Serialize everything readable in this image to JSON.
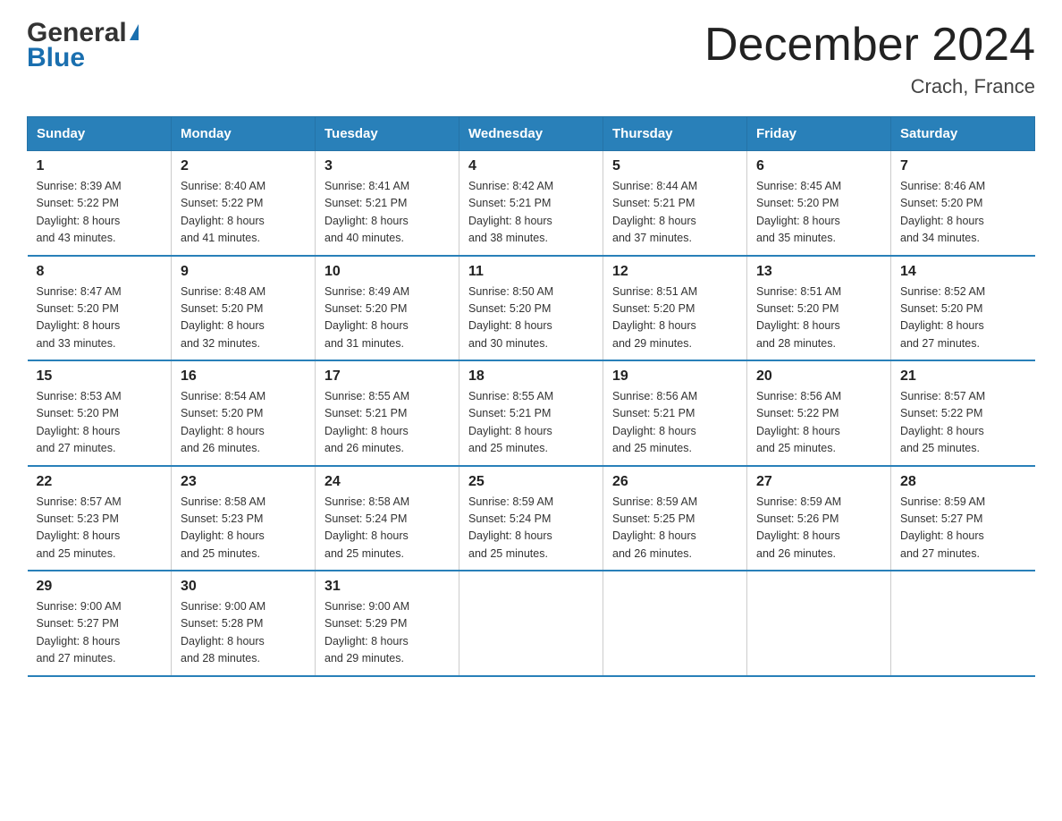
{
  "logo": {
    "general": "General",
    "triangle": "▲",
    "blue": "Blue"
  },
  "title": "December 2024",
  "subtitle": "Crach, France",
  "headers": [
    "Sunday",
    "Monday",
    "Tuesday",
    "Wednesday",
    "Thursday",
    "Friday",
    "Saturday"
  ],
  "weeks": [
    [
      {
        "day": "1",
        "sunrise": "8:39 AM",
        "sunset": "5:22 PM",
        "daylight": "8 hours and 43 minutes."
      },
      {
        "day": "2",
        "sunrise": "8:40 AM",
        "sunset": "5:22 PM",
        "daylight": "8 hours and 41 minutes."
      },
      {
        "day": "3",
        "sunrise": "8:41 AM",
        "sunset": "5:21 PM",
        "daylight": "8 hours and 40 minutes."
      },
      {
        "day": "4",
        "sunrise": "8:42 AM",
        "sunset": "5:21 PM",
        "daylight": "8 hours and 38 minutes."
      },
      {
        "day": "5",
        "sunrise": "8:44 AM",
        "sunset": "5:21 PM",
        "daylight": "8 hours and 37 minutes."
      },
      {
        "day": "6",
        "sunrise": "8:45 AM",
        "sunset": "5:20 PM",
        "daylight": "8 hours and 35 minutes."
      },
      {
        "day": "7",
        "sunrise": "8:46 AM",
        "sunset": "5:20 PM",
        "daylight": "8 hours and 34 minutes."
      }
    ],
    [
      {
        "day": "8",
        "sunrise": "8:47 AM",
        "sunset": "5:20 PM",
        "daylight": "8 hours and 33 minutes."
      },
      {
        "day": "9",
        "sunrise": "8:48 AM",
        "sunset": "5:20 PM",
        "daylight": "8 hours and 32 minutes."
      },
      {
        "day": "10",
        "sunrise": "8:49 AM",
        "sunset": "5:20 PM",
        "daylight": "8 hours and 31 minutes."
      },
      {
        "day": "11",
        "sunrise": "8:50 AM",
        "sunset": "5:20 PM",
        "daylight": "8 hours and 30 minutes."
      },
      {
        "day": "12",
        "sunrise": "8:51 AM",
        "sunset": "5:20 PM",
        "daylight": "8 hours and 29 minutes."
      },
      {
        "day": "13",
        "sunrise": "8:51 AM",
        "sunset": "5:20 PM",
        "daylight": "8 hours and 28 minutes."
      },
      {
        "day": "14",
        "sunrise": "8:52 AM",
        "sunset": "5:20 PM",
        "daylight": "8 hours and 27 minutes."
      }
    ],
    [
      {
        "day": "15",
        "sunrise": "8:53 AM",
        "sunset": "5:20 PM",
        "daylight": "8 hours and 27 minutes."
      },
      {
        "day": "16",
        "sunrise": "8:54 AM",
        "sunset": "5:20 PM",
        "daylight": "8 hours and 26 minutes."
      },
      {
        "day": "17",
        "sunrise": "8:55 AM",
        "sunset": "5:21 PM",
        "daylight": "8 hours and 26 minutes."
      },
      {
        "day": "18",
        "sunrise": "8:55 AM",
        "sunset": "5:21 PM",
        "daylight": "8 hours and 25 minutes."
      },
      {
        "day": "19",
        "sunrise": "8:56 AM",
        "sunset": "5:21 PM",
        "daylight": "8 hours and 25 minutes."
      },
      {
        "day": "20",
        "sunrise": "8:56 AM",
        "sunset": "5:22 PM",
        "daylight": "8 hours and 25 minutes."
      },
      {
        "day": "21",
        "sunrise": "8:57 AM",
        "sunset": "5:22 PM",
        "daylight": "8 hours and 25 minutes."
      }
    ],
    [
      {
        "day": "22",
        "sunrise": "8:57 AM",
        "sunset": "5:23 PM",
        "daylight": "8 hours and 25 minutes."
      },
      {
        "day": "23",
        "sunrise": "8:58 AM",
        "sunset": "5:23 PM",
        "daylight": "8 hours and 25 minutes."
      },
      {
        "day": "24",
        "sunrise": "8:58 AM",
        "sunset": "5:24 PM",
        "daylight": "8 hours and 25 minutes."
      },
      {
        "day": "25",
        "sunrise": "8:59 AM",
        "sunset": "5:24 PM",
        "daylight": "8 hours and 25 minutes."
      },
      {
        "day": "26",
        "sunrise": "8:59 AM",
        "sunset": "5:25 PM",
        "daylight": "8 hours and 26 minutes."
      },
      {
        "day": "27",
        "sunrise": "8:59 AM",
        "sunset": "5:26 PM",
        "daylight": "8 hours and 26 minutes."
      },
      {
        "day": "28",
        "sunrise": "8:59 AM",
        "sunset": "5:27 PM",
        "daylight": "8 hours and 27 minutes."
      }
    ],
    [
      {
        "day": "29",
        "sunrise": "9:00 AM",
        "sunset": "5:27 PM",
        "daylight": "8 hours and 27 minutes."
      },
      {
        "day": "30",
        "sunrise": "9:00 AM",
        "sunset": "5:28 PM",
        "daylight": "8 hours and 28 minutes."
      },
      {
        "day": "31",
        "sunrise": "9:00 AM",
        "sunset": "5:29 PM",
        "daylight": "8 hours and 29 minutes."
      },
      null,
      null,
      null,
      null
    ]
  ],
  "labels": {
    "sunrise": "Sunrise:",
    "sunset": "Sunset:",
    "daylight": "Daylight:"
  }
}
